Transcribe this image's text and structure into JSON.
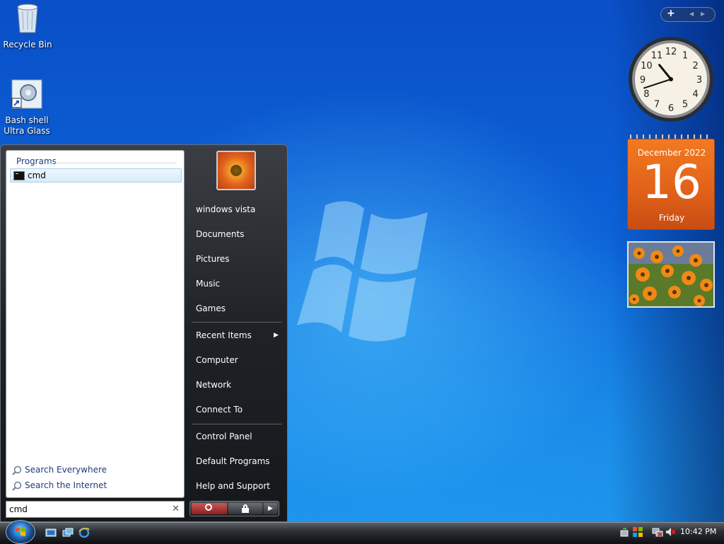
{
  "desktop": {
    "icons": [
      {
        "label": "Recycle Bin",
        "icon": "recycle-bin-icon"
      },
      {
        "label": "Bash shell Ultra Glass",
        "icon": "shortcut-gear-icon"
      }
    ]
  },
  "start_menu": {
    "programs_header": "Programs",
    "program_results": [
      {
        "label": "cmd",
        "icon": "command-prompt-icon"
      }
    ],
    "search_everywhere": "Search Everywhere",
    "search_internet": "Search the Internet",
    "search_value": "cmd",
    "right_items": {
      "user": "windows vista",
      "documents": "Documents",
      "pictures": "Pictures",
      "music": "Music",
      "games": "Games",
      "recent_items": "Recent Items",
      "computer": "Computer",
      "network": "Network",
      "connect_to": "Connect To",
      "control_panel": "Control Panel",
      "default_programs": "Default Programs",
      "help_support": "Help and Support"
    }
  },
  "gadgets": {
    "clock": {
      "hour": 10,
      "minute": 42
    },
    "calendar": {
      "month_year": "December 2022",
      "day": "16",
      "weekday": "Friday"
    }
  },
  "taskbar": {
    "time": "10:42 PM"
  },
  "colors": {
    "desktop": "#0c63d8",
    "calendar": "#e0601a",
    "power": "#a33a38"
  }
}
